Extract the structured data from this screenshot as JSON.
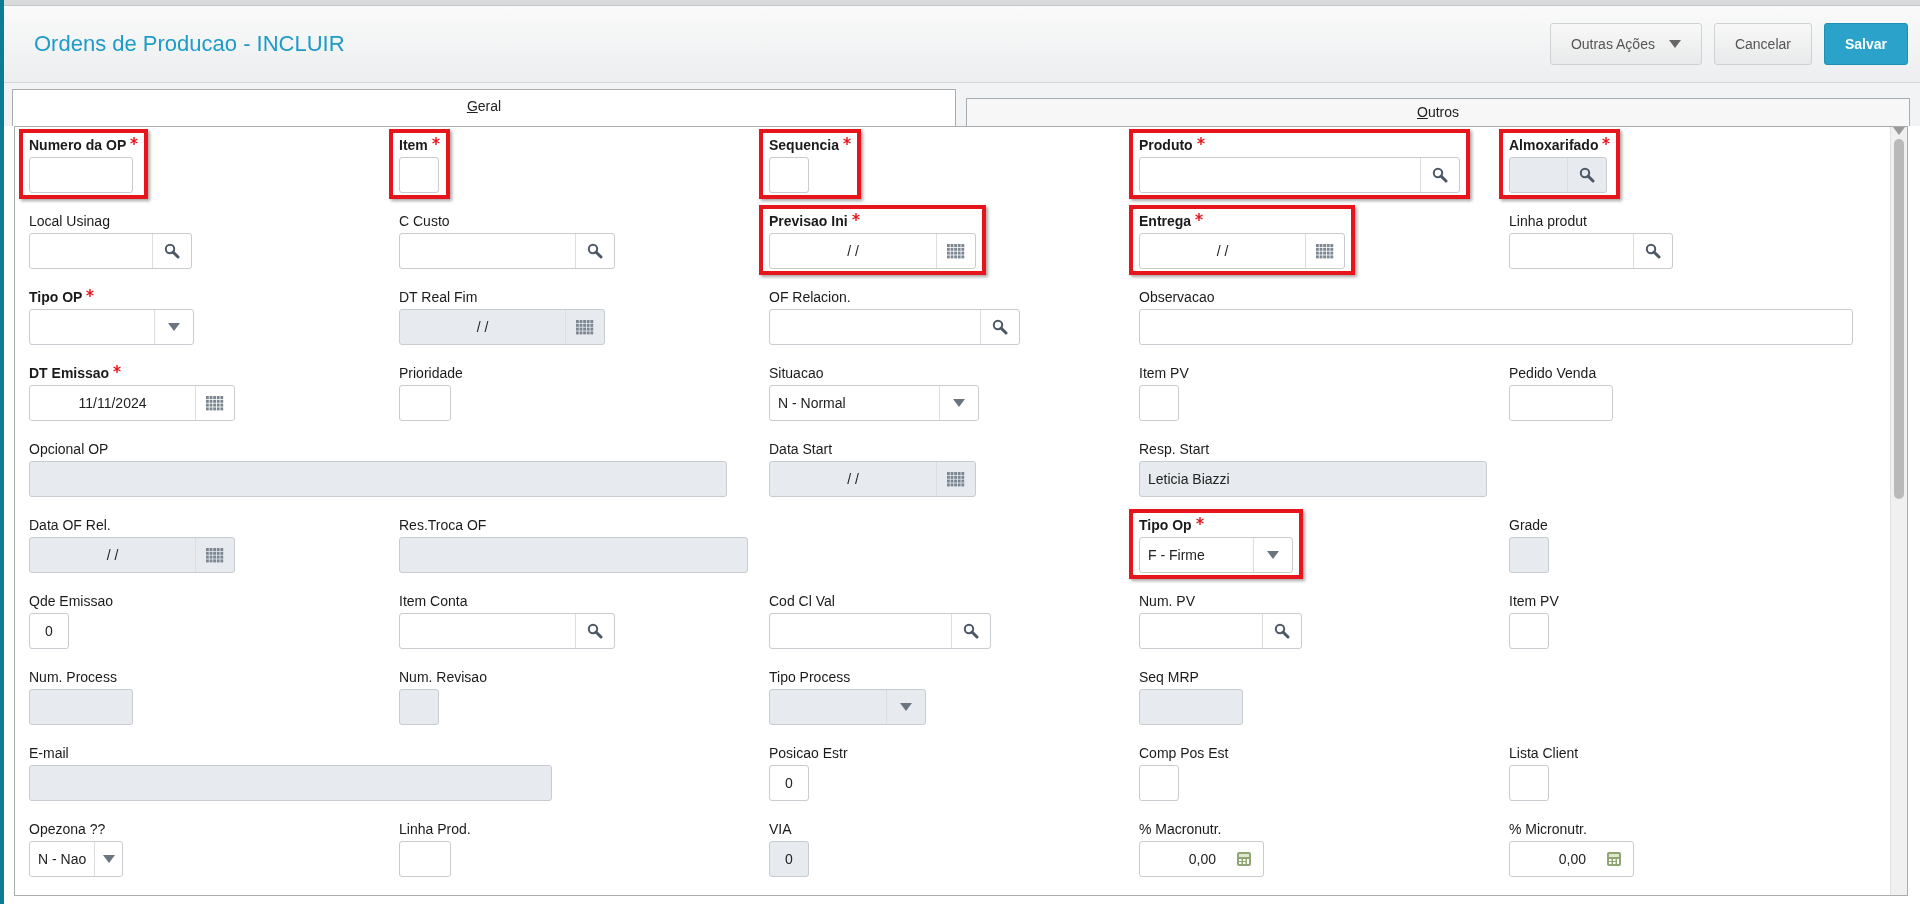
{
  "header": {
    "title": "Ordens de Producao - INCLUIR",
    "buttons": [
      {
        "label": "Outras Ações",
        "kind": "menu"
      },
      {
        "label": "Cancelar",
        "kind": "plain"
      },
      {
        "label": "Salvar",
        "kind": "primary"
      }
    ]
  },
  "tabs": [
    {
      "label": "Geral",
      "selected": true
    },
    {
      "label": "Outros",
      "selected": false
    }
  ],
  "rows": [
    [
      {
        "label": "Numero da OP",
        "kind": "text",
        "required": true,
        "disabled": false,
        "highlighted": true
      },
      {
        "label": "Item",
        "kind": "text",
        "required": true,
        "disabled": false,
        "highlighted": true
      },
      {
        "label": "Sequencia",
        "kind": "text",
        "required": true,
        "disabled": false,
        "highlighted": true
      },
      {
        "label": "Produto",
        "kind": "lookup",
        "required": true,
        "disabled": false,
        "highlighted": true
      },
      {
        "label": "Almoxarifado",
        "kind": "lookup",
        "required": true,
        "disabled": true,
        "highlighted": true
      }
    ],
    [
      {
        "label": "Local Usinag",
        "kind": "lookup",
        "required": false,
        "disabled": false,
        "highlighted": false
      },
      {
        "label": "C Custo",
        "kind": "lookup",
        "required": false,
        "disabled": false,
        "highlighted": false
      },
      {
        "label": "Previsao Ini",
        "kind": "date",
        "value": "/  /",
        "required": true,
        "disabled": false,
        "highlighted": true
      },
      {
        "label": "Entrega",
        "kind": "date",
        "value": "/  /",
        "required": true,
        "disabled": false,
        "highlighted": true
      },
      {
        "label": "Linha produt",
        "kind": "lookup",
        "required": false,
        "disabled": false,
        "highlighted": false
      }
    ],
    [
      {
        "label": "Tipo OP",
        "kind": "select",
        "required": true,
        "disabled": false,
        "highlighted": false
      },
      {
        "label": "DT Real Fim",
        "kind": "date",
        "value": "/  /",
        "required": false,
        "disabled": true,
        "highlighted": false
      },
      {
        "label": "OF Relacion.",
        "kind": "lookup",
        "required": false,
        "disabled": false,
        "highlighted": false
      },
      {
        "label": "Observacao",
        "kind": "text",
        "required": false,
        "disabled": false,
        "highlighted": false
      }
    ],
    [
      {
        "label": "DT Emissao",
        "kind": "date",
        "value": "11/11/2024",
        "required": true,
        "disabled": false,
        "highlighted": false
      },
      {
        "label": "Prioridade",
        "kind": "text",
        "required": false,
        "disabled": false,
        "highlighted": false
      },
      {
        "label": "Situacao",
        "kind": "select",
        "value": "N - Normal",
        "required": false,
        "disabled": false,
        "highlighted": false
      },
      {
        "label": "Item PV",
        "kind": "text",
        "required": false,
        "disabled": false,
        "highlighted": false
      },
      {
        "label": "Pedido Venda",
        "kind": "text",
        "required": false,
        "disabled": false,
        "highlighted": false
      }
    ],
    [
      {
        "label": "Opcional OP",
        "kind": "text",
        "required": false,
        "disabled": true,
        "highlighted": false
      },
      {
        "label": "Data Start",
        "kind": "date",
        "value": "/  /",
        "required": false,
        "disabled": true,
        "highlighted": false
      },
      {
        "label": "Resp. Start",
        "kind": "text",
        "value": "Leticia Biazzi",
        "required": false,
        "disabled": true,
        "highlighted": false
      }
    ],
    [
      {
        "label": "Data OF Rel.",
        "kind": "date",
        "value": "/  /",
        "required": false,
        "disabled": true,
        "highlighted": false
      },
      {
        "label": "Res.Troca OF",
        "kind": "text",
        "required": false,
        "disabled": true,
        "highlighted": false
      },
      {
        "label": "Tipo Op",
        "kind": "select",
        "value": "F - Firme",
        "required": true,
        "disabled": false,
        "highlighted": true
      },
      {
        "label": "Grade",
        "kind": "text",
        "required": false,
        "disabled": true,
        "highlighted": false
      }
    ],
    [
      {
        "label": "Qde Emissao",
        "kind": "text",
        "value": "0",
        "required": false,
        "disabled": false,
        "highlighted": false
      },
      {
        "label": "Item Conta",
        "kind": "lookup",
        "required": false,
        "disabled": false,
        "highlighted": false
      },
      {
        "label": "Cod Cl Val",
        "kind": "lookup",
        "required": false,
        "disabled": false,
        "highlighted": false
      },
      {
        "label": "Num. PV",
        "kind": "lookup",
        "required": false,
        "disabled": false,
        "highlighted": false
      },
      {
        "label": "Item PV",
        "kind": "text",
        "required": false,
        "disabled": false,
        "highlighted": false
      }
    ],
    [
      {
        "label": "Num. Process",
        "kind": "text",
        "required": false,
        "disabled": true,
        "highlighted": false
      },
      {
        "label": "Num. Revisao",
        "kind": "text",
        "required": false,
        "disabled": true,
        "highlighted": false
      },
      {
        "label": "Tipo Process",
        "kind": "select",
        "required": false,
        "disabled": true,
        "highlighted": false
      },
      {
        "label": "Seq MRP",
        "kind": "text",
        "required": false,
        "disabled": true,
        "highlighted": false
      }
    ],
    [
      {
        "label": "E-mail",
        "kind": "text",
        "required": false,
        "disabled": true,
        "highlighted": false
      },
      {
        "label": "Posicao Estr",
        "kind": "text",
        "value": "0",
        "required": false,
        "disabled": false,
        "highlighted": false
      },
      {
        "label": "Comp Pos Est",
        "kind": "text",
        "required": false,
        "disabled": false,
        "highlighted": false
      },
      {
        "label": "Lista Client",
        "kind": "text",
        "required": false,
        "disabled": false,
        "highlighted": false
      }
    ],
    [
      {
        "label": "Opezona ??",
        "kind": "select",
        "value": "N - Nao",
        "required": false,
        "disabled": false,
        "highlighted": false
      },
      {
        "label": "Linha Prod.",
        "kind": "text",
        "required": false,
        "disabled": false,
        "highlighted": false
      },
      {
        "label": "VIA",
        "kind": "text",
        "value": "0",
        "required": false,
        "disabled": true,
        "highlighted": false
      },
      {
        "label": "% Macronutr.",
        "kind": "calc",
        "value": "0,00",
        "required": false,
        "disabled": false,
        "highlighted": false
      },
      {
        "label": "% Micronutr.",
        "kind": "calc",
        "value": "0,00",
        "required": false,
        "disabled": false,
        "highlighted": false
      }
    ]
  ]
}
